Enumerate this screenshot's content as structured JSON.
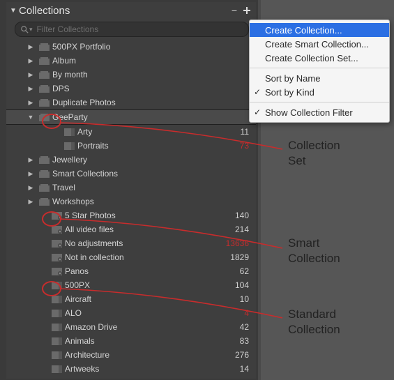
{
  "panel": {
    "title": "Collections"
  },
  "search": {
    "placeholder": "Filter Collections"
  },
  "rows": [
    {
      "label": "500PX Portfolio",
      "count": "",
      "set": true
    },
    {
      "label": "Album",
      "count": "",
      "set": true
    },
    {
      "label": "By month",
      "count": "",
      "set": true
    },
    {
      "label": "DPS",
      "count": "",
      "set": true
    },
    {
      "label": "Duplicate Photos",
      "count": "",
      "set": true
    },
    {
      "label": "GeeParty",
      "count": "",
      "set": true
    },
    {
      "label": "Arty",
      "count": "11"
    },
    {
      "label": "Portraits",
      "count": "73"
    },
    {
      "label": "Jewellery",
      "count": "",
      "set": true
    },
    {
      "label": "Smart Collections",
      "count": "",
      "set": true
    },
    {
      "label": "Travel",
      "count": "",
      "set": true
    },
    {
      "label": "Workshops",
      "count": "",
      "set": true
    },
    {
      "label": "5 Star Photos",
      "count": "140"
    },
    {
      "label": "All video files",
      "count": "214"
    },
    {
      "label": "No adjustments",
      "count": "13636"
    },
    {
      "label": "Not in collection",
      "count": "1829"
    },
    {
      "label": "Panos",
      "count": "62"
    },
    {
      "label": "500PX",
      "count": "104"
    },
    {
      "label": "Aircraft",
      "count": "10"
    },
    {
      "label": "ALO",
      "count": "4"
    },
    {
      "label": "Amazon Drive",
      "count": "42"
    },
    {
      "label": "Animals",
      "count": "83"
    },
    {
      "label": "Architecture",
      "count": "276"
    },
    {
      "label": "Artweeks",
      "count": "14"
    }
  ],
  "menu": {
    "create_collection": "Create Collection...",
    "create_smart": "Create Smart Collection...",
    "create_set": "Create Collection Set...",
    "sort_name": "Sort by Name",
    "sort_kind": "Sort by Kind",
    "show_filter": "Show Collection Filter"
  },
  "annotations": {
    "set": "Collection\nSet",
    "smart": "Smart\nCollection",
    "standard": "Standard\nCollection"
  }
}
